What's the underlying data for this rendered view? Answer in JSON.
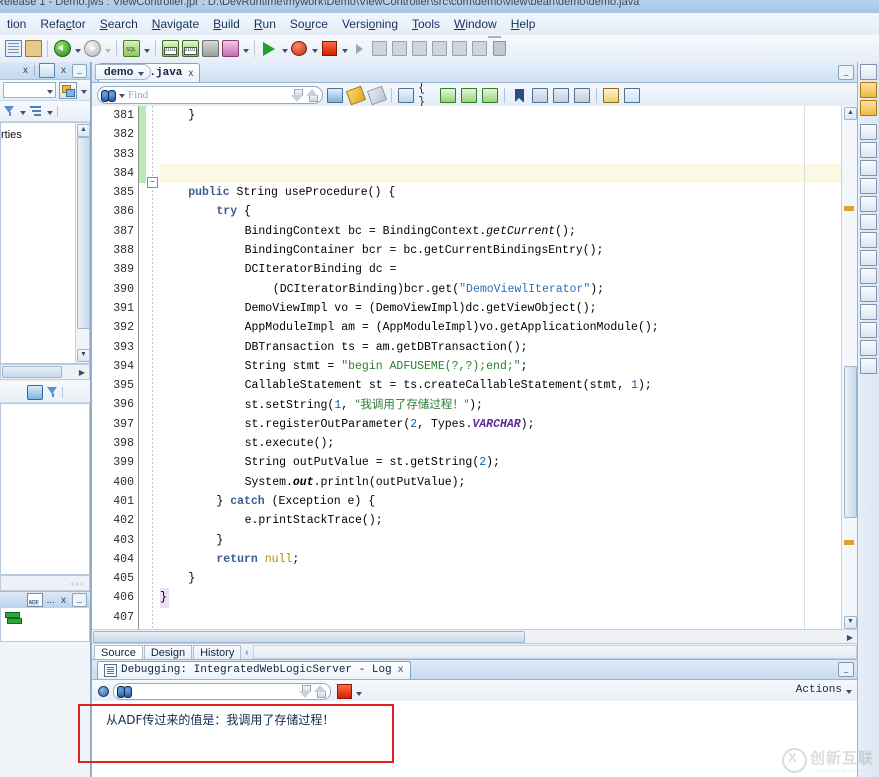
{
  "window": {
    "title": "Release 1 - Demo.jws : ViewController.jpr : D:\\DevRuntime\\mywork\\Demo\\ViewController\\src\\com\\demo\\view\\bean\\demo\\demo.java"
  },
  "menubar": {
    "items": [
      {
        "label": "tion",
        "mnemonic": ""
      },
      {
        "label": "Refactor",
        "mnemonic": "c"
      },
      {
        "label": "Search",
        "mnemonic": "S"
      },
      {
        "label": "Navigate",
        "mnemonic": "N"
      },
      {
        "label": "Build",
        "mnemonic": "B"
      },
      {
        "label": "Run",
        "mnemonic": "R"
      },
      {
        "label": "Source",
        "mnemonic": "u"
      },
      {
        "label": "Versioning",
        "mnemonic": "o"
      },
      {
        "label": "Tools",
        "mnemonic": "T"
      },
      {
        "label": "Window",
        "mnemonic": "W"
      },
      {
        "label": "Help",
        "mnemonic": "H"
      }
    ]
  },
  "toolbar": {
    "buttons": [
      {
        "name": "copy-icon",
        "tip": "Copy"
      },
      {
        "name": "paste-icon",
        "tip": "Paste"
      },
      {
        "name": "navigate-back-icon",
        "tip": "Back"
      },
      {
        "name": "navigate-forward-icon",
        "tip": "Forward"
      },
      {
        "name": "sql-worksheet-icon",
        "tip": "SQL Worksheet"
      },
      {
        "name": "make-icon",
        "tip": "Make"
      },
      {
        "name": "rebuild-icon",
        "tip": "Rebuild"
      },
      {
        "name": "deploy-icon",
        "tip": "Deploy"
      },
      {
        "name": "run-manager-icon",
        "tip": "Run Manager"
      },
      {
        "name": "run-icon",
        "tip": "Run"
      },
      {
        "name": "debug-icon",
        "tip": "Debug"
      },
      {
        "name": "terminate-icon",
        "tip": "Terminate"
      },
      {
        "name": "resume-icon",
        "tip": "Resume"
      },
      {
        "name": "step-over-icon",
        "tip": "Step Over"
      },
      {
        "name": "step-into-icon",
        "tip": "Step Into"
      },
      {
        "name": "step-out-icon",
        "tip": "Step Out"
      },
      {
        "name": "step-to-end-icon",
        "tip": "Step To End Of Method"
      },
      {
        "name": "pause-icon",
        "tip": "Pause"
      },
      {
        "name": "trash-icon",
        "tip": "Delete"
      }
    ]
  },
  "left_panel": {
    "node_label": "roperties",
    "close_label": "x",
    "minimize_label": "_",
    "bottom_close_label": "x",
    "bottom_dots": "..."
  },
  "editor": {
    "tab": {
      "label": "demo.java",
      "close": "x",
      "icon": "java-file-icon"
    },
    "minimize_label": "_",
    "find": {
      "placeholder": "Find",
      "value": ""
    },
    "breadcrumb": {
      "label": "demo"
    },
    "design_tabs": [
      {
        "label": "Source",
        "active": true
      },
      {
        "label": "Design",
        "active": false
      },
      {
        "label": "History",
        "active": false
      }
    ],
    "first_line_number": 381,
    "lines": [
      {
        "n": 381,
        "indent": 4,
        "html": "}"
      },
      {
        "n": 382,
        "indent": 0,
        "html": ""
      },
      {
        "n": 383,
        "indent": 0,
        "html": ""
      },
      {
        "n": 384,
        "indent": 0,
        "html": "",
        "hl": "yellow"
      },
      {
        "n": 385,
        "indent": 4,
        "html": "<span class='kw'>public</span> String useProcedure() {",
        "fold": true
      },
      {
        "n": 386,
        "indent": 8,
        "html": "<span class='kw'>try</span> {"
      },
      {
        "n": 387,
        "indent": 12,
        "html": "BindingContext bc = BindingContext.<span class='ital'>getCurrent</span>();"
      },
      {
        "n": 388,
        "indent": 12,
        "html": "BindingContainer bcr = bc.getCurrentBindingsEntry();"
      },
      {
        "n": 389,
        "indent": 12,
        "html": "DCIteratorBinding dc ="
      },
      {
        "n": 390,
        "indent": 16,
        "html": "(DCIteratorBinding)bcr.get(<span class='strblue'>\"DemoViewlIterator\"</span>);"
      },
      {
        "n": 391,
        "indent": 12,
        "html": "DemoViewImpl vo = (DemoViewImpl)dc.getViewObject();"
      },
      {
        "n": 392,
        "indent": 12,
        "html": "AppModuleImpl am = (AppModuleImpl)vo.getApplicationModule();"
      },
      {
        "n": 393,
        "indent": 12,
        "html": "DBTransaction ts = am.getDBTransaction();"
      },
      {
        "n": 394,
        "indent": 12,
        "html": "String stmt = <span class='str'>\"begin ADFUSEME(?,?);end;\"</span>;"
      },
      {
        "n": 395,
        "indent": 12,
        "html": "CallableStatement st = ts.createCallableStatement(stmt, <span class='num'>1</span>);"
      },
      {
        "n": 396,
        "indent": 12,
        "html": "st.setString(<span class='num'>1</span>, <span class='str-cn'>\"我调用了存储过程！\"</span>);"
      },
      {
        "n": 397,
        "indent": 12,
        "html": "st.registerOutParameter(<span class='num'>2</span>, Types.<span class='fieldc'>VARCHAR</span>);"
      },
      {
        "n": 398,
        "indent": 12,
        "html": "st.execute();"
      },
      {
        "n": 399,
        "indent": 12,
        "html": "String outPutValue = st.getString(<span class='num'>2</span>);"
      },
      {
        "n": 400,
        "indent": 12,
        "html": "System.<span class='ital' style='font-weight:bold'>out</span>.println(outPutValue);"
      },
      {
        "n": 401,
        "indent": 8,
        "html": "} <span class='kw'>catch</span> (Exception e) {"
      },
      {
        "n": 402,
        "indent": 12,
        "html": "e.printStackTrace();"
      },
      {
        "n": 403,
        "indent": 8,
        "html": "}"
      },
      {
        "n": 404,
        "indent": 8,
        "html": "<span class='kw'>return</span> <span class='nul'>null</span>;"
      },
      {
        "n": 405,
        "indent": 4,
        "html": "}"
      },
      {
        "n": 406,
        "indent": 0,
        "html": "}",
        "hl": "lilac"
      },
      {
        "n": 407,
        "indent": 0,
        "html": ""
      }
    ]
  },
  "log_panel": {
    "tab": {
      "label": "Debugging: IntegratedWebLogicServer - Log",
      "close": "x",
      "icon": "log-icon"
    },
    "minimize_label": "_",
    "actions_label": "Actions",
    "find": {
      "placeholder": "",
      "value": ""
    },
    "output_line": "从ADF传过来的值是：我调用了存储过程！"
  },
  "watermark": {
    "text": "创新互联",
    "subtext": "CHUANG XIN HU LIAN"
  },
  "colors": {
    "accent": "#2b6fb5",
    "string": "#2e7d32",
    "keyword": "#3a5f8f",
    "annotation_red": "#e02020",
    "highlight_yellow": "#fbf8e3",
    "highlight_lilac": "#eadff5",
    "changebar_green": "#b6ebb6"
  }
}
